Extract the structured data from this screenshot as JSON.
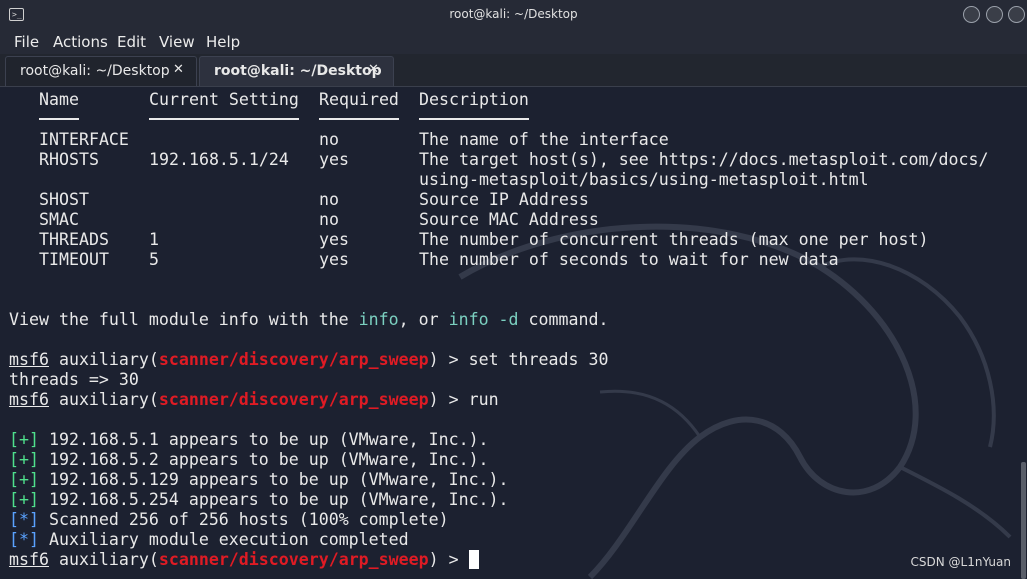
{
  "window": {
    "title": "root@kali: ~/Desktop",
    "app_icon_glyph": ">_"
  },
  "menu": [
    "File",
    "Actions",
    "Edit",
    "View",
    "Help"
  ],
  "tabs": [
    {
      "label": "root@kali: ~/Desktop",
      "close": "✕",
      "active": false
    },
    {
      "label": "root@kali: ~/Desktop",
      "close": "✕",
      "active": true
    }
  ],
  "options_table": {
    "headers": [
      "Name",
      "Current Setting",
      "Required",
      "Description"
    ],
    "rows": [
      {
        "name": "INTERFACE",
        "setting": "",
        "required": "no",
        "description": "The name of the interface"
      },
      {
        "name": "RHOSTS",
        "setting": "192.168.5.1/24",
        "required": "yes",
        "description": "The target host(s), see https://docs.metasploit.com/docs/",
        "description2": "using-metasploit/basics/using-metasploit.html"
      },
      {
        "name": "SHOST",
        "setting": "",
        "required": "no",
        "description": "Source IP Address"
      },
      {
        "name": "SMAC",
        "setting": "",
        "required": "no",
        "description": "Source MAC Address"
      },
      {
        "name": "THREADS",
        "setting": "1",
        "required": "yes",
        "description": "The number of concurrent threads (max one per host)"
      },
      {
        "name": "TIMEOUT",
        "setting": "5",
        "required": "yes",
        "description": "The number of seconds to wait for new data"
      }
    ]
  },
  "info_line": {
    "pre": "View the full module info with the ",
    "cmd1": "info",
    "mid": ", or ",
    "cmd2": "info -d",
    "post": " command."
  },
  "prompt": {
    "msf": "msf6",
    "module_pre": " auxiliary(",
    "module": "scanner/discovery/arp_sweep",
    "module_post": ") > "
  },
  "commands": {
    "cmd1": "set threads 30",
    "cmd1_output": "threads => 30",
    "cmd2": "run"
  },
  "results": [
    {
      "tag": "[+]",
      "text": " 192.168.5.1 appears to be up (VMware, Inc.)."
    },
    {
      "tag": "[+]",
      "text": " 192.168.5.2 appears to be up (VMware, Inc.)."
    },
    {
      "tag": "[+]",
      "text": " 192.168.5.129 appears to be up (VMware, Inc.)."
    },
    {
      "tag": "[+]",
      "text": " 192.168.5.254 appears to be up (VMware, Inc.)."
    },
    {
      "tag": "[*]",
      "text": " Scanned 256 of 256 hosts (100% complete)"
    },
    {
      "tag": "[*]",
      "text": " Auxiliary module execution completed"
    }
  ],
  "watermark": "CSDN @L1nYuan",
  "colors": {
    "terminal_bg": "#1c2130",
    "prompt_red": "#e01b24",
    "plus_green": "#4fe08c",
    "star_blue": "#5aa2ff",
    "info_teal": "#7bd0c0"
  }
}
